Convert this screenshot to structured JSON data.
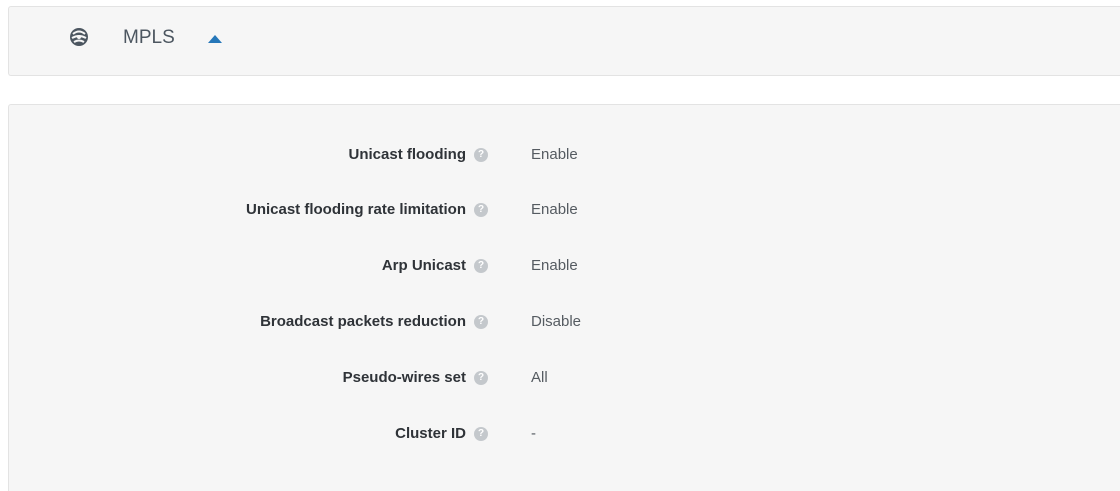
{
  "header": {
    "icon": "mpls-network-icon",
    "title": "MPLS",
    "toggle_icon": "caret-up-icon",
    "accent_color": "#2677b9"
  },
  "properties": [
    {
      "label": "Unicast flooding",
      "help_icon": "help-icon",
      "value": "Enable"
    },
    {
      "label": "Unicast flooding rate limitation",
      "help_icon": "help-icon",
      "value": "Enable"
    },
    {
      "label": "Arp Unicast",
      "help_icon": "help-icon",
      "value": "Enable"
    },
    {
      "label": "Broadcast packets reduction",
      "help_icon": "help-icon",
      "value": "Disable"
    },
    {
      "label": "Pseudo-wires set",
      "help_icon": "help-icon",
      "value": "All"
    },
    {
      "label": "Cluster ID",
      "help_icon": "help-icon",
      "value": "-"
    }
  ]
}
